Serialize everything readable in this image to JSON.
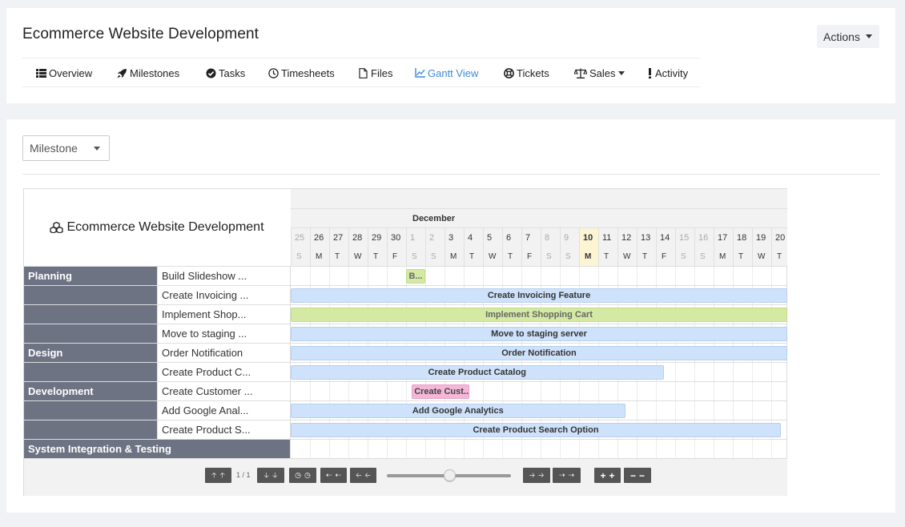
{
  "header": {
    "title": "Ecommerce Website Development",
    "actions_label": "Actions"
  },
  "tabs": [
    {
      "label": "Overview",
      "icon": "list-icon"
    },
    {
      "label": "Milestones",
      "icon": "rocket-icon"
    },
    {
      "label": "Tasks",
      "icon": "check-circle-icon"
    },
    {
      "label": "Timesheets",
      "icon": "clock-icon"
    },
    {
      "label": "Files",
      "icon": "file-icon"
    },
    {
      "label": "Gantt View",
      "icon": "chart-line-icon",
      "active": true
    },
    {
      "label": "Tickets",
      "icon": "life-ring-icon"
    },
    {
      "label": "Sales",
      "icon": "balance-scale-icon",
      "dropdown": true
    },
    {
      "label": "Activity",
      "icon": "exclamation-icon"
    }
  ],
  "filter": {
    "selected": "Milestone"
  },
  "gantt": {
    "project_title": "Ecommerce Website Development",
    "month": "December",
    "days": [
      {
        "n": "25",
        "w": "S",
        "weekend": true
      },
      {
        "n": "26",
        "w": "M"
      },
      {
        "n": "27",
        "w": "T"
      },
      {
        "n": "28",
        "w": "W"
      },
      {
        "n": "29",
        "w": "T"
      },
      {
        "n": "30",
        "w": "F"
      },
      {
        "n": "1",
        "w": "S",
        "weekend": true
      },
      {
        "n": "2",
        "w": "S",
        "weekend": true
      },
      {
        "n": "3",
        "w": "M"
      },
      {
        "n": "4",
        "w": "T"
      },
      {
        "n": "5",
        "w": "W"
      },
      {
        "n": "6",
        "w": "T"
      },
      {
        "n": "7",
        "w": "F"
      },
      {
        "n": "8",
        "w": "S",
        "weekend": true
      },
      {
        "n": "9",
        "w": "S",
        "weekend": true
      },
      {
        "n": "10",
        "w": "M",
        "today": true
      },
      {
        "n": "11",
        "w": "T"
      },
      {
        "n": "12",
        "w": "W"
      },
      {
        "n": "13",
        "w": "T"
      },
      {
        "n": "14",
        "w": "F"
      },
      {
        "n": "15",
        "w": "S",
        "weekend": true
      },
      {
        "n": "16",
        "w": "S",
        "weekend": true
      },
      {
        "n": "17",
        "w": "M"
      },
      {
        "n": "18",
        "w": "T"
      },
      {
        "n": "19",
        "w": "W"
      },
      {
        "n": "20",
        "w": "T"
      }
    ],
    "rows": [
      {
        "group": "Planning",
        "task": "Build Slideshow ...",
        "bar": {
          "label": "B...",
          "color": "green",
          "start": 6,
          "span": 1.0
        }
      },
      {
        "group": "",
        "task": "Create Invoicing ...",
        "bar": {
          "label": "Create Invoicing Feature",
          "color": "blue",
          "start": 0,
          "span": 26
        }
      },
      {
        "group": "",
        "task": "Implement Shop...",
        "bar": {
          "label": "Implement Shopping Cart",
          "color": "green",
          "start": 0,
          "span": 26
        }
      },
      {
        "group": "",
        "task": "Move to staging ...",
        "bar": {
          "label": "Move to staging server",
          "color": "blue",
          "start": 0,
          "span": 26
        }
      },
      {
        "group": "Design",
        "task": "Order Notification",
        "bar": {
          "label": "Order Notification",
          "color": "blue",
          "start": 0,
          "span": 26
        }
      },
      {
        "group": "",
        "task": "Create Product C...",
        "bar": {
          "label": "Create Product Catalog",
          "color": "blue",
          "start": 0,
          "span": 19.4
        }
      },
      {
        "group": "Development",
        "task": "Create Customer ...",
        "bar": {
          "label": "Create Cust...",
          "color": "pink",
          "start": 6.3,
          "span": 3
        }
      },
      {
        "group": "",
        "task": "Add Google Anal...",
        "bar": {
          "label": "Add Google Analytics",
          "color": "blue",
          "start": 0,
          "span": 17.4
        }
      },
      {
        "group": "",
        "task": "Create Product S...",
        "bar": {
          "label": "Create Product Search Option",
          "color": "blue",
          "start": 0,
          "span": 25.5
        }
      },
      {
        "group": "System Integration & Testing",
        "task": "",
        "wide": true
      }
    ],
    "pager": "1 / 1"
  },
  "colors": {
    "accent": "#3e8ad8",
    "group_bg": "#6e7383",
    "bar_blue": "#cfe2fb",
    "bar_green": "#d4e9a4",
    "bar_pink": "#f4b7d9",
    "today_bg": "#fdf4d4"
  }
}
